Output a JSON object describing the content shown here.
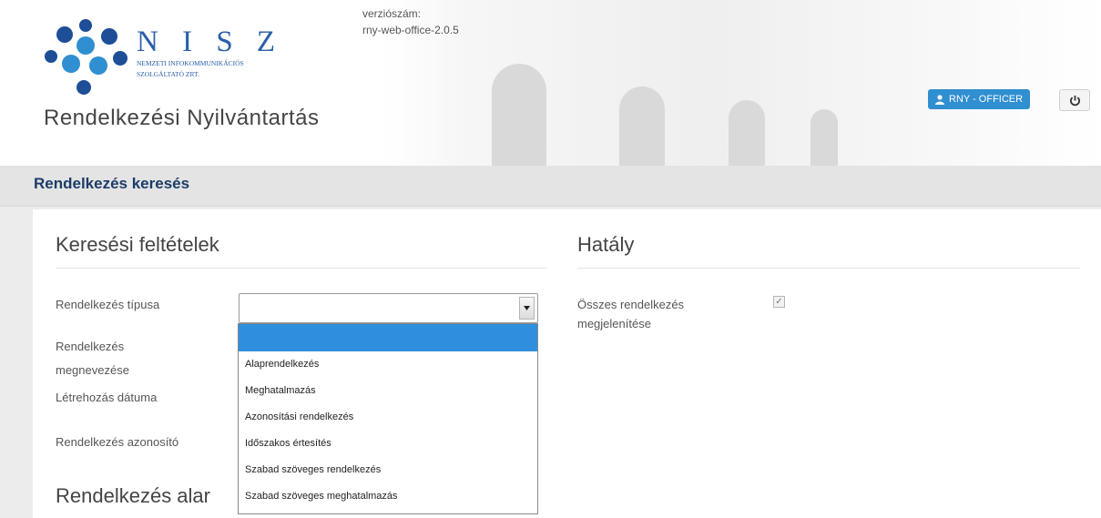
{
  "header": {
    "logo": {
      "name": "N I S Z",
      "subtitle_line1": "NEMZETI INFOKOMMUNIKÁCIÓS",
      "subtitle_line2": "SZOLGÁLTATÓ ZRT."
    },
    "app_title": "Rendelkezési Nyilvántartás",
    "version_label": "verziószám:",
    "version_value": "rny-web-office-2.0.5",
    "user_label": "RNY - OFFICER",
    "user_icon": "user-icon",
    "logout_icon": "power-icon"
  },
  "page": {
    "title": "Rendelkezés keresés"
  },
  "search": {
    "section_title": "Keresési feltételek",
    "type_label": "Rendelkezés típusa",
    "name_label_line1": "Rendelkezés",
    "name_label_line2": "megnevezése",
    "date_label": "Létrehozás dátuma",
    "id_label": "Rendelkezés azonosító",
    "type_select": {
      "value": "",
      "options": [
        "",
        "Alaprendelkezés",
        "Meghatalmazás",
        "Azonosítási rendelkezés",
        "Időszakos értesítés",
        "Szabad szöveges rendelkezés",
        "Szabad szöveges meghatalmazás"
      ]
    }
  },
  "hataly": {
    "section_title": "Hatály",
    "show_all_label_line1": "Összes rendelkezés",
    "show_all_label_line2": "megjelenítése",
    "show_all_checked": true,
    "check_mark": "✓"
  },
  "basis": {
    "section_title": "Rendelkezés alar"
  },
  "colors": {
    "brand_blue": "#2a60a8",
    "accent": "#2f8fd0",
    "title_navy": "#1c3c68",
    "dropdown_highlight": "#2f8fde"
  }
}
